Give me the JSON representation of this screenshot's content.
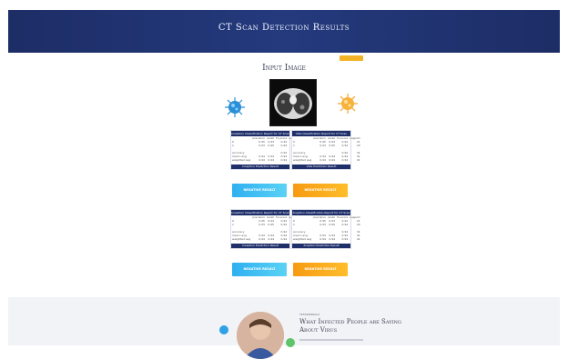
{
  "header": {
    "title": "CT Scan Detection Results"
  },
  "tag": {
    "label": ""
  },
  "input": {
    "title": "Input Image",
    "image_icon": "ct-scan-image",
    "left_icon": "virus-blue-icon",
    "right_icon": "virus-orange-icon"
  },
  "panels": [
    {
      "head": "Inception Classification Report for CT Scan",
      "rows": [
        [
          "",
          "precision",
          "recall",
          "f1-score",
          "support"
        ],
        [
          "0",
          "0.95",
          "0.93",
          "0.94",
          "21"
        ],
        [
          "1",
          "0.93",
          "0.95",
          "0.94",
          "20"
        ],
        [
          "",
          "",
          "",
          "",
          ""
        ],
        [
          "accuracy",
          "",
          "",
          "0.94",
          "41"
        ],
        [
          "macro avg",
          "0.94",
          "0.94",
          "0.94",
          "41"
        ],
        [
          "weighted avg",
          "0.94",
          "0.94",
          "0.94",
          "41"
        ]
      ],
      "result": "Inception Prediction Result",
      "button": "NEGATIVE RESULT",
      "style": "blue"
    },
    {
      "head": "VGG Classification Report for CT Scan",
      "rows": [
        [
          "",
          "precision",
          "recall",
          "f1-score",
          "support"
        ],
        [
          "0",
          "0.95",
          "0.93",
          "0.94",
          "21"
        ],
        [
          "1",
          "0.93",
          "0.95",
          "0.94",
          "20"
        ],
        [
          "",
          "",
          "",
          "",
          ""
        ],
        [
          "accuracy",
          "",
          "",
          "0.94",
          "41"
        ],
        [
          "macro avg",
          "0.94",
          "0.94",
          "0.94",
          "41"
        ],
        [
          "weighted avg",
          "0.94",
          "0.94",
          "0.94",
          "41"
        ]
      ],
      "result": "VGG Prediction Result",
      "button": "NEGATIVE RESULT",
      "style": "orange"
    },
    {
      "head": "Inception Classification Report for CT Scan",
      "rows": [
        [
          "",
          "precision",
          "recall",
          "f1-score",
          "support"
        ],
        [
          "0",
          "0.95",
          "0.93",
          "0.94",
          "21"
        ],
        [
          "1",
          "0.93",
          "0.95",
          "0.94",
          "20"
        ],
        [
          "",
          "",
          "",
          "",
          ""
        ],
        [
          "accuracy",
          "",
          "",
          "0.94",
          "41"
        ],
        [
          "macro avg",
          "0.94",
          "0.94",
          "0.94",
          "41"
        ],
        [
          "weighted avg",
          "0.94",
          "0.94",
          "0.94",
          "41"
        ]
      ],
      "result": "Inception Prediction Result",
      "button": "NEGATIVE RESULT",
      "style": "blue"
    },
    {
      "head": "Xception Classification Report for CT Scan",
      "rows": [
        [
          "",
          "precision",
          "recall",
          "f1-score",
          "support"
        ],
        [
          "0",
          "0.95",
          "0.93",
          "0.94",
          "21"
        ],
        [
          "1",
          "0.93",
          "0.95",
          "0.94",
          "20"
        ],
        [
          "",
          "",
          "",
          "",
          ""
        ],
        [
          "accuracy",
          "",
          "",
          "0.94",
          "41"
        ],
        [
          "macro avg",
          "0.94",
          "0.94",
          "0.94",
          "41"
        ],
        [
          "weighted avg",
          "0.94",
          "0.94",
          "0.94",
          "41"
        ]
      ],
      "result": "Xception Prediction Result",
      "button": "NEGATIVE RESULT",
      "style": "orange"
    }
  ],
  "testimonial": {
    "eyebrow": "TESTIMONIALS",
    "title": "What Infected People are Saying About Virus",
    "avatar_icon": "person-avatar"
  },
  "colors": {
    "header": "#1d2d66",
    "accent_blue": "#2fb0f0",
    "accent_orange": "#f79a12"
  }
}
